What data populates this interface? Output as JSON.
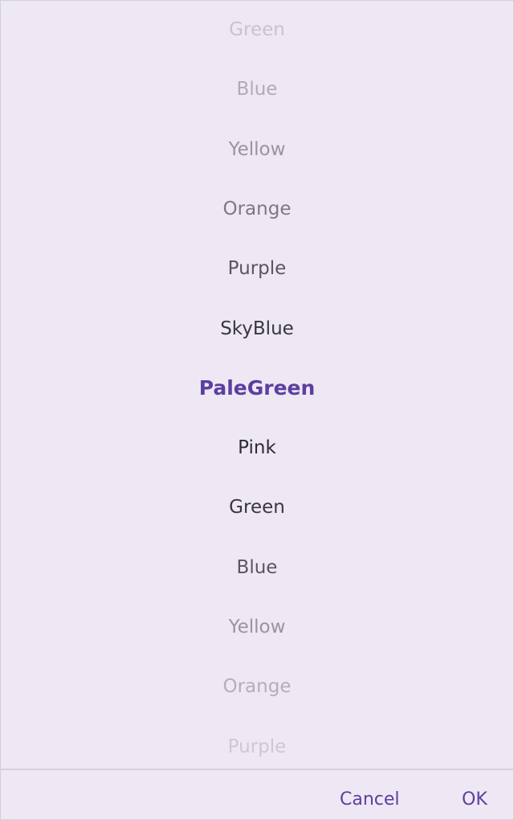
{
  "picker": {
    "items": [
      {
        "label": "Green",
        "color": "#c8c3cb"
      },
      {
        "label": "Blue",
        "color": "#b0abb4"
      },
      {
        "label": "Yellow",
        "color": "#99949d"
      },
      {
        "label": "Orange",
        "color": "#7d7882"
      },
      {
        "label": "Purple",
        "color": "#5a5560"
      },
      {
        "label": "SkyBlue",
        "color": "#3a363f"
      },
      {
        "label": "PaleGreen",
        "color": "#5c3fa0",
        "selected": true
      },
      {
        "label": "Pink",
        "color": "#2f2b33"
      },
      {
        "label": "Green",
        "color": "#3a363f"
      },
      {
        "label": "Blue",
        "color": "#5a5560"
      },
      {
        "label": "Yellow",
        "color": "#99949d"
      },
      {
        "label": "Orange",
        "color": "#b3aeb7"
      },
      {
        "label": "Purple",
        "color": "#cdc8d1"
      }
    ]
  },
  "footer": {
    "cancel_label": "Cancel",
    "ok_label": "OK"
  },
  "colors": {
    "accent": "#5c3fa0",
    "background": "#eee8f4"
  }
}
